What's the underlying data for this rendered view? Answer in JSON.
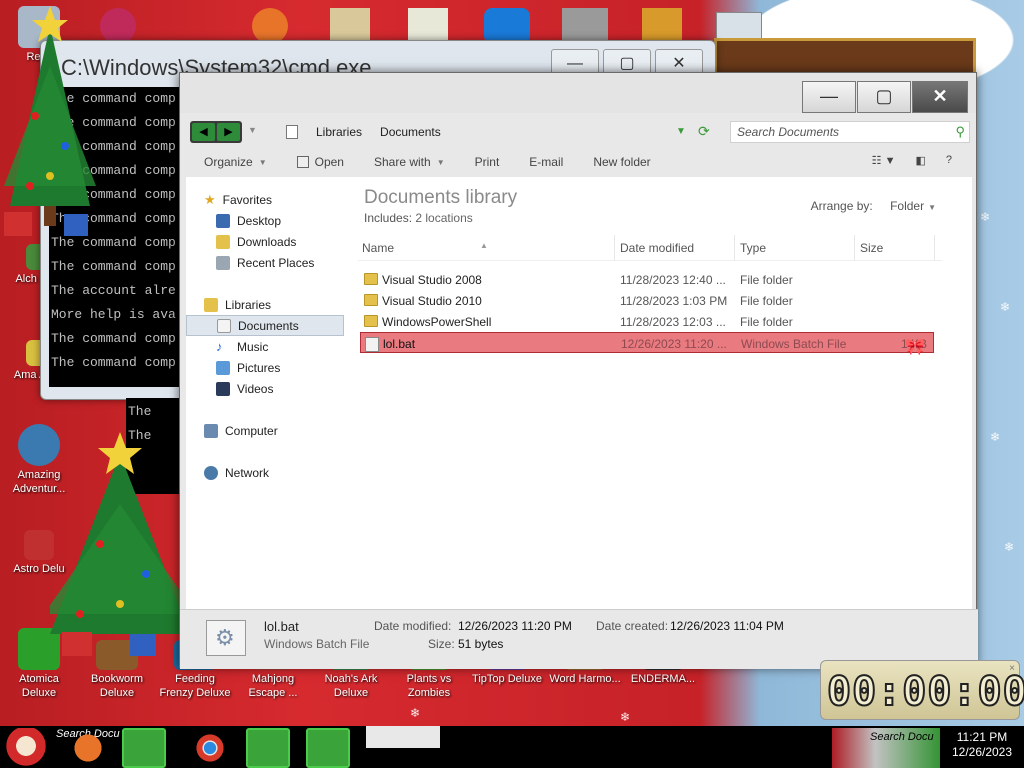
{
  "cmd_window": {
    "title": "C:\\Windows\\System32\\cmd.exe",
    "controls": {
      "minimize": "—",
      "maximize": "▢",
      "close": "✕"
    },
    "lines": [
      "The command comp",
      "The command comp",
      "The command comp",
      "The command comp",
      "The command comp",
      "The command comp",
      "The command comp",
      "The command comp",
      "The account alre",
      "More help is ava",
      "The command comp",
      "The command comp"
    ],
    "lines2": [
      "The",
      "The"
    ]
  },
  "desktop_icons": [
    {
      "label": "Recy",
      "color": "#a8b8c8"
    },
    {
      "label": "Alch Delu",
      "color": "#4a8a3a"
    },
    {
      "label": "Ama Adve",
      "color": "#d8c040"
    },
    {
      "label": "Amazing Adventur...",
      "color": "#3a7ab0"
    },
    {
      "label": "Astro Delu",
      "color": "#c03030"
    },
    {
      "label": "Atomica Deluxe",
      "color": "#2aa02a"
    },
    {
      "label": "Bookworm Deluxe",
      "color": "#8a5a2a"
    },
    {
      "label": "Feeding Frenzy Deluxe",
      "color": "#1a6aa0"
    },
    {
      "label": "Mahjong Escape ...",
      "color": "#b04040"
    },
    {
      "label": "Noah's Ark Deluxe",
      "color": "#3a8a50"
    },
    {
      "label": "Plants vs Zombies",
      "color": "#4a9a2a"
    },
    {
      "label": "TipTop Deluxe",
      "color": "#6a3a9a"
    },
    {
      "label": "Word Harmo...",
      "color": "#a06a2a"
    },
    {
      "label": "ENDERMA...",
      "color": "#303030"
    }
  ],
  "explorer": {
    "controls": {
      "minimize": "—",
      "maximize": "▢",
      "close": "✕"
    },
    "nav": {
      "back": "◀",
      "forward": "▶"
    },
    "breadcrumb": [
      "Libraries",
      "Documents"
    ],
    "search_placeholder": "Search Documents",
    "toolbar": {
      "organize": "Organize",
      "open": "Open",
      "share_with": "Share with",
      "print": "Print",
      "email": "E-mail",
      "new_folder": "New folder",
      "help": "?"
    },
    "nav_pane": {
      "favorites": "Favorites",
      "desktop": "Desktop",
      "downloads": "Downloads",
      "recent_places": "Recent Places",
      "libraries": "Libraries",
      "documents": "Documents",
      "music": "Music",
      "pictures": "Pictures",
      "videos": "Videos",
      "computer": "Computer",
      "network": "Network"
    },
    "library": {
      "title": "Documents library",
      "includes_label": "Includes:",
      "includes_value": "2 locations",
      "arrange_label": "Arrange by:",
      "arrange_value": "Folder"
    },
    "columns": {
      "name": "Name",
      "date": "Date modified",
      "type": "Type",
      "size": "Size"
    },
    "files": [
      {
        "name": "Visual Studio 2008",
        "date": "11/28/2023 12:40 ...",
        "type": "File folder",
        "size": "",
        "kind": "folder"
      },
      {
        "name": "Visual Studio 2010",
        "date": "11/28/2023 1:03 PM",
        "type": "File folder",
        "size": "",
        "kind": "folder"
      },
      {
        "name": "WindowsPowerShell",
        "date": "11/28/2023 12:03 ...",
        "type": "File folder",
        "size": "",
        "kind": "folder"
      },
      {
        "name": "lol.bat",
        "date": "12/26/2023 11:20 ...",
        "type": "Windows Batch File",
        "size": "1 KB",
        "kind": "bat"
      }
    ],
    "details": {
      "name": "lol.bat",
      "type": "Windows Batch File",
      "date_modified_label": "Date modified:",
      "date_modified": "12/26/2023 11:20 PM",
      "date_created_label": "Date created:",
      "date_created": "12/26/2023 11:04 PM",
      "size_label": "Size:",
      "size": "51 bytes"
    }
  },
  "timer": {
    "digits": "00:00:00",
    "close": "×"
  },
  "taskbar": {
    "search_hint": "Search Docu",
    "tray_search": "Search Docu",
    "time": "11:21 PM",
    "date": "12/26/2023",
    "apps": [
      "firefox-icon",
      "explorer-icon",
      "chrome-icon",
      "tree-icon",
      "cmd-icon"
    ]
  },
  "colors": {
    "selection": "#e87a80",
    "accent_green": "#3aa43a",
    "desktop_red": "#c8242a"
  }
}
